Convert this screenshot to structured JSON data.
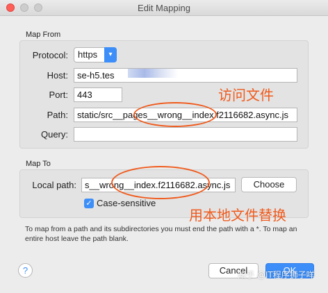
{
  "window": {
    "title": "Edit Mapping"
  },
  "map_from": {
    "section_label": "Map From",
    "protocol_label": "Protocol:",
    "protocol_value": "https",
    "host_label": "Host:",
    "host_value": "se-h5.tes",
    "port_label": "Port:",
    "port_value": "443",
    "path_label": "Path:",
    "path_value": "static/src__pages__wrong__index.f2116682.async.js",
    "query_label": "Query:",
    "query_value": ""
  },
  "map_to": {
    "section_label": "Map To",
    "local_path_label": "Local path:",
    "local_path_value": "s__wrong__index.f2116682.async.js",
    "choose_label": "Choose",
    "case_sensitive_label": "Case-sensitive",
    "case_sensitive_checked": true
  },
  "hint_text": "To map from a path and its subdirectories you must end the path with a *. To map an entire host leave the path blank.",
  "buttons": {
    "help": "?",
    "cancel": "Cancel",
    "ok": "OK"
  },
  "annotations": {
    "access_file": "访问文件",
    "replace_local": "用本地文件替换"
  },
  "watermark": "知乎 @IT程序狮子咩",
  "colors": {
    "accent": "#3d8ef8",
    "annotation": "#f05a1c"
  }
}
